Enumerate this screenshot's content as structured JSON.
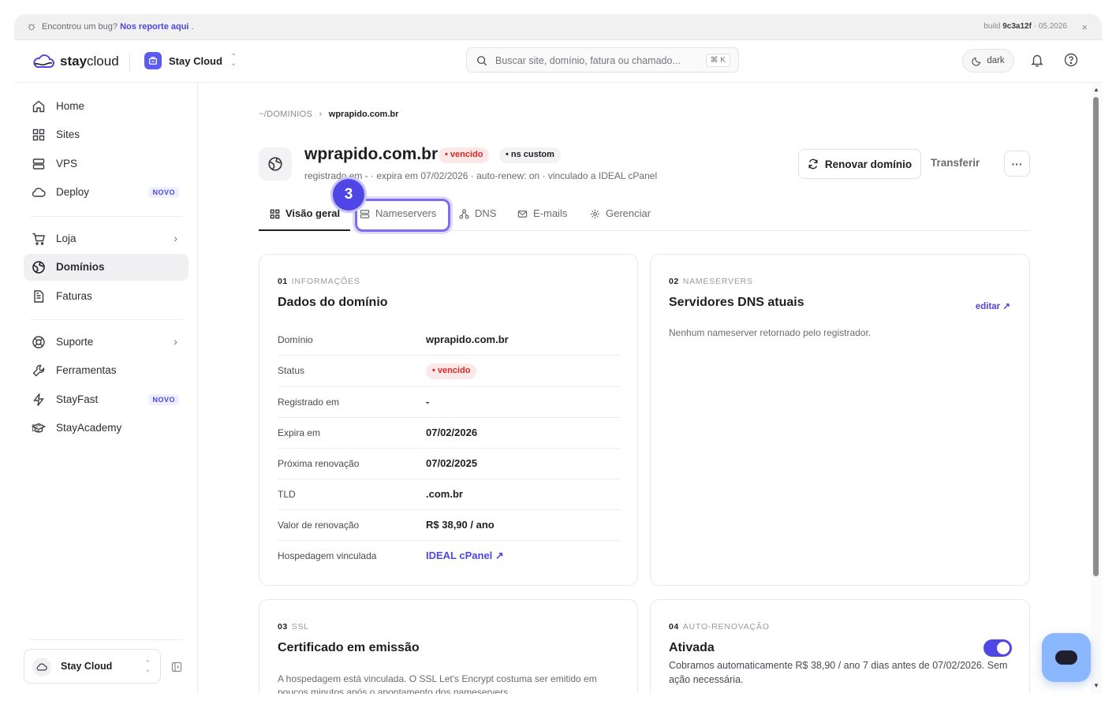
{
  "bugbar": {
    "text": "Encontrou um bug?",
    "link": "Nos reporte aqui",
    "suffix": " .",
    "build_label": "build ",
    "build_hash": "9c3a12f",
    "build_date": " · 05.2026",
    "close": "×"
  },
  "header": {
    "brand_bold": "stay",
    "brand_rest": "cloud",
    "workspace": "Stay Cloud",
    "search_placeholder": "Buscar site, domínio, fatura ou chamado...",
    "search_shortcut": "⌘ K",
    "theme_label": "dark"
  },
  "sidebar": {
    "items": [
      {
        "label": "Home"
      },
      {
        "label": "Sites"
      },
      {
        "label": "VPS"
      },
      {
        "label": "Deploy",
        "badge": "NOVO"
      },
      {
        "label": "Loja"
      },
      {
        "label": "Domínios"
      },
      {
        "label": "Faturas"
      },
      {
        "label": "Suporte"
      },
      {
        "label": "Ferramentas"
      },
      {
        "label": "StayFast",
        "badge": "NOVO"
      },
      {
        "label": "StayAcademy"
      }
    ],
    "account": "Stay Cloud"
  },
  "main": {
    "breadcrumb_parent": "~/DOMINIOS",
    "breadcrumb_sep": "›",
    "breadcrumb_current": "wprapido.com.br",
    "domain_title": "wprapido.com.br",
    "status_pill": "• vencido",
    "ns_pill": "• ns custom",
    "subtitle": "registrado em - · expira em 07/02/2026 · auto-renew: on · vinculado a IDEAL cPanel",
    "renew_button": "Renovar domínio",
    "transfer_button": "Transferir",
    "more_button": "···",
    "step_number": "3",
    "tabs": [
      {
        "label": "Visão geral"
      },
      {
        "label": "Nameservers"
      },
      {
        "label": "DNS"
      },
      {
        "label": "E-mails"
      },
      {
        "label": "Gerenciar"
      }
    ]
  },
  "card_info": {
    "num": "01",
    "kicker": "INFORMAÇÕES",
    "title": "Dados do domínio",
    "rows": [
      {
        "k": "Domínio",
        "v": "wprapido.com.br"
      },
      {
        "k": "Status",
        "v": "• vencido"
      },
      {
        "k": "Registrado em",
        "v": "-"
      },
      {
        "k": "Expira em",
        "v": "07/02/2026"
      },
      {
        "k": "Próxima renovação",
        "v": "07/02/2025"
      },
      {
        "k": "TLD",
        "v": ".com.br"
      },
      {
        "k": "Valor de renovação",
        "v": "R$ 38,90 / ano"
      },
      {
        "k": "Hospedagem vinculada",
        "v": "IDEAL cPanel ↗"
      }
    ]
  },
  "card_ns": {
    "num": "02",
    "kicker": "NAMESERVERS",
    "title": "Servidores DNS atuais",
    "edit": "editar ↗",
    "empty": "Nenhum nameserver retornado pelo registrador."
  },
  "card_ssl": {
    "num": "03",
    "kicker": "SSL",
    "title": "Certificado em emissão",
    "text": "A hospedagem está vinculada. O SSL Let's Encrypt costuma ser emitido em poucos minutos após o apontamento dos nameservers."
  },
  "card_auto": {
    "num": "04",
    "kicker": "AUTO-RENOVAÇÃO",
    "title": "Ativada",
    "text": "Cobramos automaticamente R$ 38,90 / ano 7 dias antes de 07/02/2026. Sem ação necessária."
  },
  "colors": {
    "accent": "#4f46e5",
    "danger": "#dc2626",
    "chat": "#8ab7ff"
  }
}
